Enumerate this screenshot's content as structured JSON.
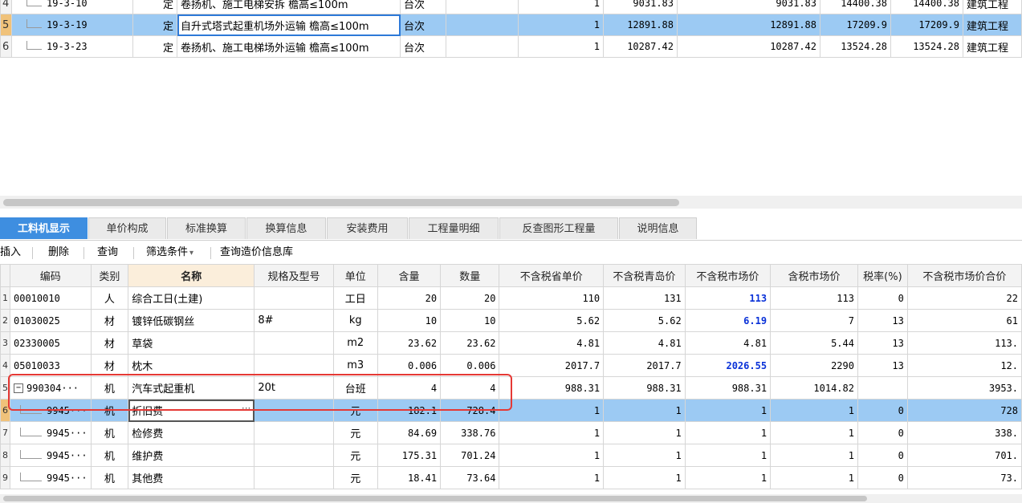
{
  "top_rows": [
    {
      "no": "4",
      "code": "19-3-10",
      "type": "定",
      "name": "卷扬机、施工电梯安拆 檐高≤100m",
      "unit": "台次",
      "spec": "",
      "qty": "1",
      "p1": "9031.83",
      "p2": "9031.83",
      "p3": "14400.38",
      "p4": "14400.38",
      "cat": "建筑工程",
      "selected": false
    },
    {
      "no": "5",
      "code": "19-3-19",
      "type": "定",
      "name": "自升式塔式起重机场外运输 檐高≤100m",
      "unit": "台次",
      "spec": "",
      "qty": "1",
      "p1": "12891.88",
      "p2": "12891.88",
      "p3": "17209.9",
      "p4": "17209.9",
      "cat": "建筑工程",
      "selected": true
    },
    {
      "no": "6",
      "code": "19-3-23",
      "type": "定",
      "name": "卷扬机、施工电梯场外运输 檐高≤100m",
      "unit": "台次",
      "spec": "",
      "qty": "1",
      "p1": "10287.42",
      "p2": "10287.42",
      "p3": "13524.28",
      "p4": "13524.28",
      "cat": "建筑工程",
      "selected": false
    }
  ],
  "tabs": [
    "工料机显示",
    "单价构成",
    "标准换算",
    "换算信息",
    "安装费用",
    "工程量明细",
    "反查图形工程量",
    "说明信息"
  ],
  "active_tab": 0,
  "toolbar": {
    "insert": "插入",
    "delete": "删除",
    "query": "查询",
    "filter": "筛选条件",
    "filter_arrow": "▾",
    "query_db": "查询造价信息库"
  },
  "columns": [
    "",
    "编码",
    "类别",
    "名称",
    "规格及型号",
    "单位",
    "含量",
    "数量",
    "不含税省单价",
    "不含税青岛价",
    "不含税市场价",
    "含税市场价",
    "税率(%)",
    "不含税市场价合价"
  ],
  "rows": [
    {
      "no": "1",
      "code": "00010010",
      "type": "人",
      "name": "综合工日(土建)",
      "spec": "",
      "unit": "工日",
      "content": "20",
      "qty": "20",
      "p_prov": "110",
      "p_qd": "131",
      "p_mkt": "113",
      "p_mkt_tax": "113",
      "tax": "0",
      "total": "22",
      "blue": true
    },
    {
      "no": "2",
      "code": "01030025",
      "type": "材",
      "name": "镀锌低碳钢丝",
      "spec": "8#",
      "unit": "kg",
      "content": "10",
      "qty": "10",
      "p_prov": "5.62",
      "p_qd": "5.62",
      "p_mkt": "6.19",
      "p_mkt_tax": "7",
      "tax": "13",
      "total": "61",
      "blue": true
    },
    {
      "no": "3",
      "code": "02330005",
      "type": "材",
      "name": "草袋",
      "spec": "",
      "unit": "m2",
      "content": "23.62",
      "qty": "23.62",
      "p_prov": "4.81",
      "p_qd": "4.81",
      "p_mkt": "4.81",
      "p_mkt_tax": "5.44",
      "tax": "13",
      "total": "113.",
      "blue": false
    },
    {
      "no": "4",
      "code": "05010033",
      "type": "材",
      "name": "枕木",
      "spec": "",
      "unit": "m3",
      "content": "0.006",
      "qty": "0.006",
      "p_prov": "2017.7",
      "p_qd": "2017.7",
      "p_mkt": "2026.55",
      "p_mkt_tax": "2290",
      "tax": "13",
      "total": "12.",
      "blue": true
    },
    {
      "no": "5",
      "code": "990304···",
      "type": "机",
      "name": "汽车式起重机",
      "spec": "20t",
      "unit": "台班",
      "content": "4",
      "qty": "4",
      "p_prov": "988.31",
      "p_qd": "988.31",
      "p_mkt": "988.31",
      "p_mkt_tax": "1014.82",
      "tax": "",
      "total": "3953.",
      "blue": false,
      "parent": true,
      "toggle": "−"
    },
    {
      "no": "6",
      "code": "9945···",
      "type": "机",
      "name": "折旧费",
      "spec": "",
      "unit": "元",
      "content": "182.1",
      "qty": "728.4",
      "p_prov": "1",
      "p_qd": "1",
      "p_mkt": "1",
      "p_mkt_tax": "1",
      "tax": "0",
      "total": "728",
      "blue": false,
      "child": true,
      "selected": true,
      "editing": true,
      "edit_mark": "···"
    },
    {
      "no": "7",
      "code": "9945···",
      "type": "机",
      "name": "检修费",
      "spec": "",
      "unit": "元",
      "content": "84.69",
      "qty": "338.76",
      "p_prov": "1",
      "p_qd": "1",
      "p_mkt": "1",
      "p_mkt_tax": "1",
      "tax": "0",
      "total": "338.",
      "blue": false,
      "child": true
    },
    {
      "no": "8",
      "code": "9945···",
      "type": "机",
      "name": "维护费",
      "spec": "",
      "unit": "元",
      "content": "175.31",
      "qty": "701.24",
      "p_prov": "1",
      "p_qd": "1",
      "p_mkt": "1",
      "p_mkt_tax": "1",
      "tax": "0",
      "total": "701.",
      "blue": false,
      "child": true
    },
    {
      "no": "9",
      "code": "9945···",
      "type": "机",
      "name": "其他费",
      "spec": "",
      "unit": "元",
      "content": "18.41",
      "qty": "73.64",
      "p_prov": "1",
      "p_qd": "1",
      "p_mkt": "1",
      "p_mkt_tax": "1",
      "tax": "0",
      "total": "73.",
      "blue": false,
      "child": true
    }
  ],
  "colors": {
    "accent": "#3e8ee0",
    "selected_row": "#9ccaf3",
    "highlight_box": "#e53935",
    "price_blue": "#0a32d8"
  }
}
